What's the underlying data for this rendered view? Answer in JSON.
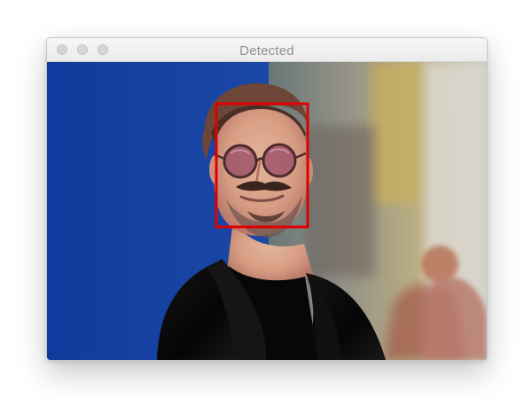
{
  "window": {
    "title": "Detected"
  },
  "colors": {
    "detection_box": "#e00000",
    "backdrop_blue": "#163b93"
  },
  "icons": {
    "close": "close-dot-icon",
    "minimize": "minimize-dot-icon",
    "zoom": "zoom-dot-icon"
  }
}
